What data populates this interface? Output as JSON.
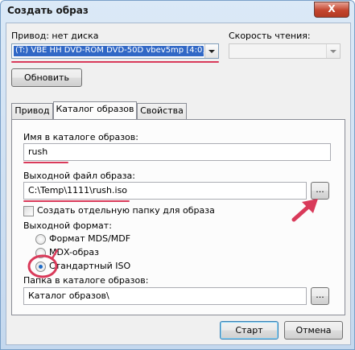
{
  "window": {
    "title": "Создать образ",
    "close_glyph": "X"
  },
  "drive": {
    "label": "Привод: нет диска",
    "selected": "(T:) VBE HH DVD-ROM DVD-50D vbev5mp [4:0]"
  },
  "speed": {
    "label": "Скорость чтения:",
    "selected": ""
  },
  "refresh_label": "Обновить",
  "tabs": [
    {
      "label": "Привод"
    },
    {
      "label": "Каталог образов"
    },
    {
      "label": "Свойства"
    }
  ],
  "catalog_name": {
    "label": "Имя в каталоге образов:",
    "value": "rush"
  },
  "output_file": {
    "label": "Выходной файл образа:",
    "value": "C:\\Temp\\1111\\rush.iso",
    "browse_label": "..."
  },
  "separate_folder": {
    "label": "Создать отдельную папку для образа",
    "checked": false
  },
  "format": {
    "label": "Выходной формат:",
    "options": [
      {
        "label": "Формат MDS/MDF",
        "selected": false
      },
      {
        "label": "MDX-образ",
        "selected": false
      },
      {
        "label": "Стандартный ISO",
        "selected": true
      }
    ]
  },
  "catalog_folder": {
    "label": "Папка в каталоге образов:",
    "value": "Каталог образов\\",
    "browse_label": "..."
  },
  "buttons": {
    "start": "Старт",
    "cancel": "Отмена"
  },
  "colors": {
    "annotation": "#d93a5a",
    "selection": "#1c6ac6"
  }
}
